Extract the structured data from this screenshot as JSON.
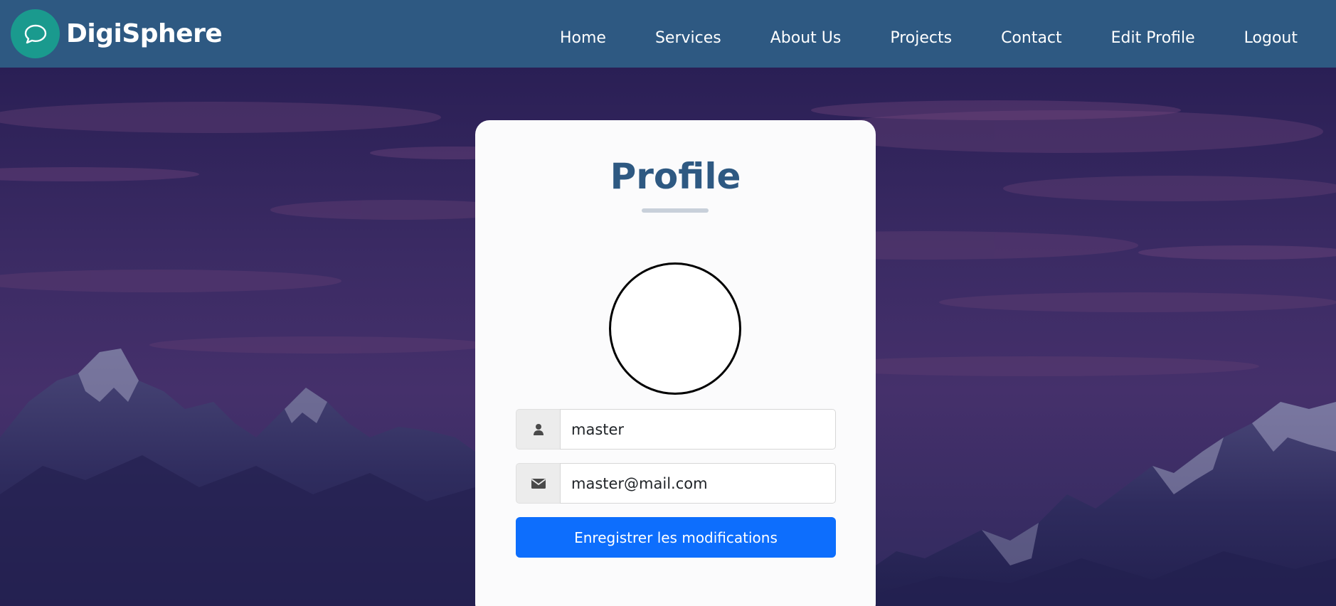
{
  "brand": {
    "name": "DigiSphere",
    "logo_icon": "chat-bubble-icon",
    "logo_color": "#1a9a8e"
  },
  "nav": {
    "items": [
      {
        "label": "Home"
      },
      {
        "label": "Services"
      },
      {
        "label": "About Us"
      },
      {
        "label": "Projects"
      },
      {
        "label": "Contact"
      },
      {
        "label": "Edit Profile"
      },
      {
        "label": "Logout"
      }
    ],
    "background": "#2e5982"
  },
  "profile": {
    "title": "Profile",
    "title_color": "#2e5982",
    "username": {
      "value": "master",
      "icon": "user-icon"
    },
    "email": {
      "value": "master@mail.com",
      "icon": "envelope-icon"
    },
    "save_label": "Enregistrer les modifications",
    "save_color": "#0d6efd"
  }
}
